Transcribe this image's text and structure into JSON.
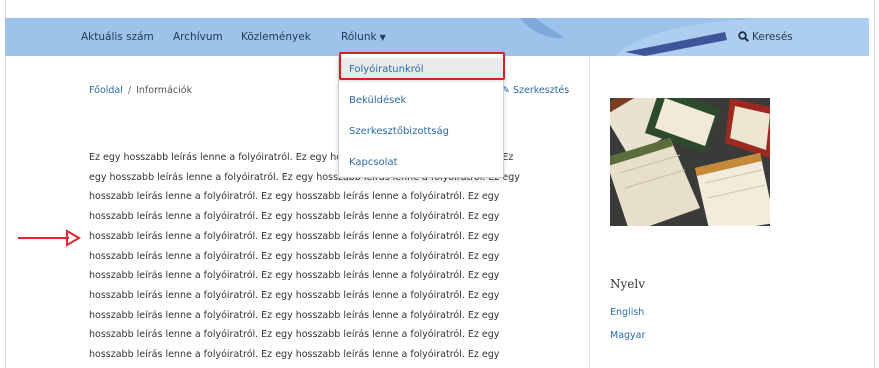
{
  "nav": {
    "items": [
      "Aktuális szám",
      "Archívum",
      "Közlemények",
      "Rólunk"
    ],
    "search_label": "Keresés"
  },
  "dropdown": {
    "items": [
      "Folyóiratunkról",
      "Beküldések",
      "Szerkesztőbizottság",
      "Kapcsolat"
    ],
    "highlighted": "Folyóiratunkról"
  },
  "breadcrumb": {
    "home": "Főoldal",
    "separator": "/",
    "current": "Információk"
  },
  "edit_link": "Szerkesztés",
  "description": {
    "lines": [
      "Ez egy hosszabb leírás lenne a folyóiratról. Ez egy hosszabb leírás lenne a folyóiratról. Ez",
      "egy hosszabb leírás lenne a folyóiratról. Ez egy hosszabb leírás lenne a folyóiratról. Ez egy",
      "hosszabb leírás lenne a folyóiratról. Ez egy hosszabb leírás lenne a folyóiratról. Ez egy",
      "hosszabb leírás lenne a folyóiratról. Ez egy hosszabb leírás lenne a folyóiratról. Ez egy",
      "hosszabb leírás lenne a folyóiratról. Ez egy hosszabb leírás lenne a folyóiratról. Ez egy",
      "hosszabb leírás lenne a folyóiratról. Ez egy hosszabb leírás lenne a folyóiratról. Ez egy",
      "hosszabb leírás lenne a folyóiratról. Ez egy hosszabb leírás lenne a folyóiratról. Ez egy",
      "hosszabb leírás lenne a folyóiratról. Ez egy hosszabb leírás lenne a folyóiratról. Ez egy",
      "hosszabb leírás lenne a folyóiratról. Ez egy hosszabb leírás lenne a folyóiratról. Ez egy",
      "hosszabb leírás lenne a folyóiratról. Ez egy hosszabb leírás lenne a folyóiratról. Ez egy",
      "hosszabb leírás lenne a folyóiratról. Ez egy hosszabb leírás lenne a folyóiratról. Ez egy"
    ]
  },
  "sidebar": {
    "language_heading": "Nyelv",
    "languages": [
      "English",
      "Magyar"
    ]
  },
  "colors": {
    "navbar": "#9ec3ea",
    "link": "#2a6aa8",
    "highlight_border": "#d61f26",
    "annotation_arrow": "#e0282e"
  }
}
